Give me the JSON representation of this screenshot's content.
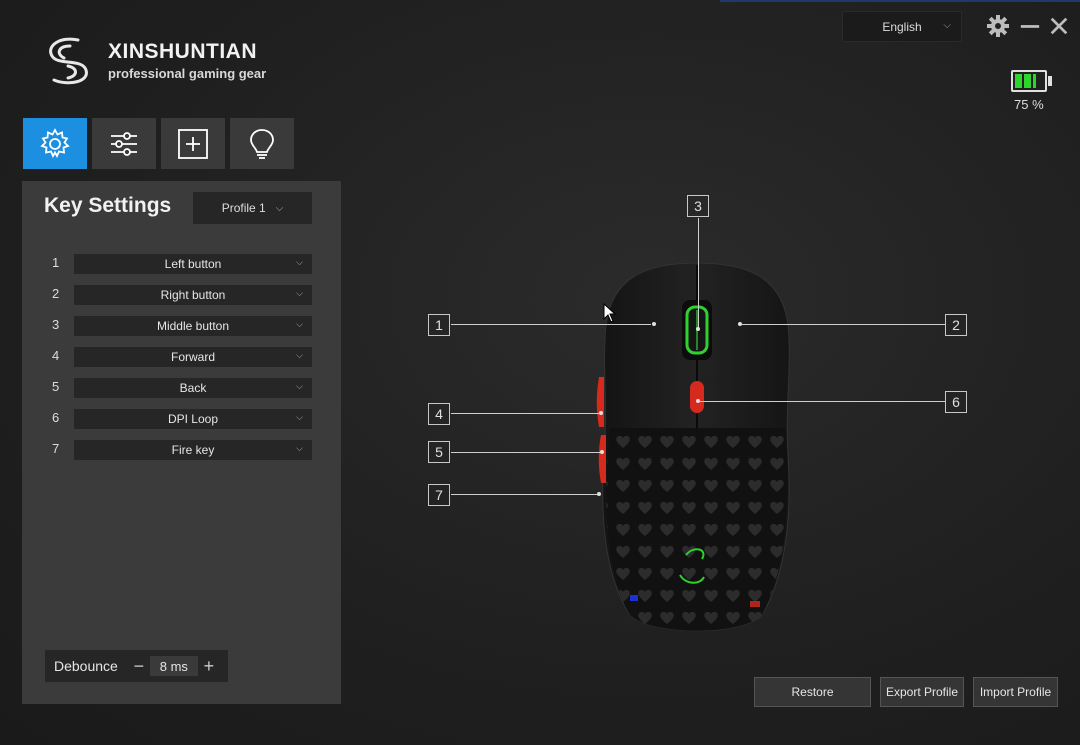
{
  "app": {
    "brand": "XINSHUNTIAN",
    "tagline": "professional gaming gear"
  },
  "header": {
    "language": "English",
    "battery_percent": 75,
    "battery_label": "75 %"
  },
  "tabs": [
    {
      "name": "key-settings",
      "icon": "gear-icon",
      "active": true
    },
    {
      "name": "performance",
      "icon": "sliders-icon",
      "active": false
    },
    {
      "name": "macro",
      "icon": "plus-box-icon",
      "active": false
    },
    {
      "name": "lighting",
      "icon": "lightbulb-icon",
      "active": false
    }
  ],
  "panel": {
    "title": "Key Settings",
    "profile": "Profile 1",
    "keys": [
      {
        "num": "1",
        "action": "Left button"
      },
      {
        "num": "2",
        "action": "Right button"
      },
      {
        "num": "3",
        "action": "Middle button"
      },
      {
        "num": "4",
        "action": "Forward"
      },
      {
        "num": "5",
        "action": "Back"
      },
      {
        "num": "6",
        "action": "DPI Loop"
      },
      {
        "num": "7",
        "action": "Fire key"
      }
    ],
    "debounce": {
      "label": "Debounce",
      "minus": "−",
      "value": "8 ms",
      "plus": "+"
    }
  },
  "callouts": [
    "1",
    "2",
    "3",
    "4",
    "5",
    "6",
    "7"
  ],
  "buttons": {
    "restore": "Restore",
    "export": "Export Profile",
    "import": "Import Profile"
  },
  "colors": {
    "accent": "#1c8fe0",
    "battery": "#2ed52e",
    "side_buttons": "#d62a1e",
    "wheel_glow": "#2fd12f"
  }
}
